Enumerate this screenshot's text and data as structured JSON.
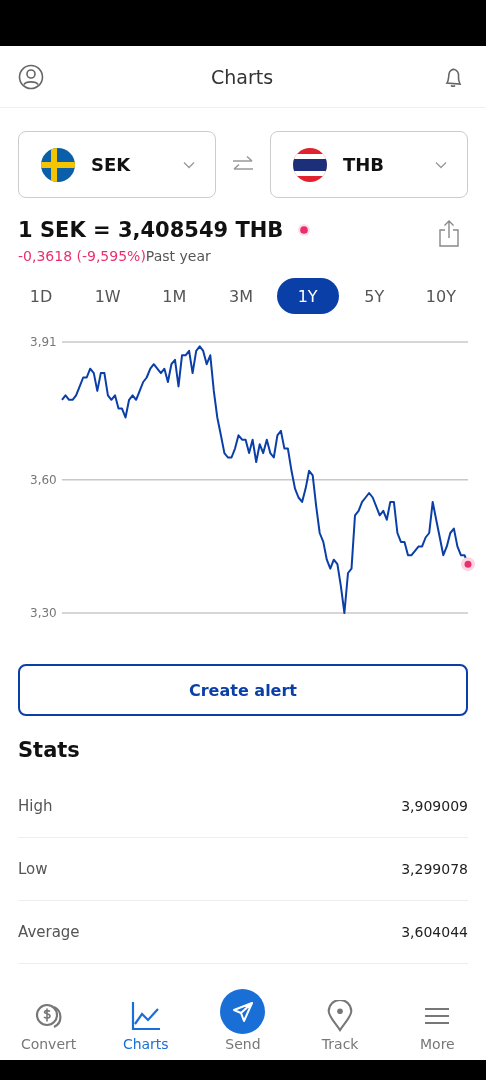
{
  "header": {
    "title": "Charts"
  },
  "pair": {
    "from": {
      "code": "SEK"
    },
    "to": {
      "code": "THB"
    }
  },
  "rate": {
    "text": "1 SEK = 3,408549 THB",
    "change": "-0,3618 (-9,595%)",
    "period": "Past year"
  },
  "periods": [
    {
      "label": "1D",
      "selected": false
    },
    {
      "label": "1W",
      "selected": false
    },
    {
      "label": "1M",
      "selected": false
    },
    {
      "label": "3M",
      "selected": false
    },
    {
      "label": "1Y",
      "selected": true
    },
    {
      "label": "5Y",
      "selected": false
    },
    {
      "label": "10Y",
      "selected": false
    }
  ],
  "chart": {
    "chart_data": {
      "type": "line",
      "ylim": [
        3.3,
        3.91
      ],
      "yticks": [
        {
          "value": 3.91,
          "label": "3,91"
        },
        {
          "value": 3.6,
          "label": "3,60"
        },
        {
          "value": 3.3,
          "label": "3,30"
        }
      ],
      "series": [
        {
          "color": "#0b3fa8",
          "values": [
            3.78,
            3.79,
            3.78,
            3.78,
            3.79,
            3.81,
            3.83,
            3.83,
            3.85,
            3.84,
            3.8,
            3.84,
            3.84,
            3.79,
            3.78,
            3.79,
            3.76,
            3.76,
            3.74,
            3.78,
            3.79,
            3.78,
            3.8,
            3.82,
            3.83,
            3.85,
            3.86,
            3.85,
            3.84,
            3.85,
            3.82,
            3.86,
            3.87,
            3.81,
            3.88,
            3.88,
            3.89,
            3.84,
            3.89,
            3.9,
            3.89,
            3.86,
            3.88,
            3.8,
            3.74,
            3.7,
            3.66,
            3.65,
            3.65,
            3.67,
            3.7,
            3.69,
            3.69,
            3.66,
            3.69,
            3.64,
            3.68,
            3.66,
            3.69,
            3.66,
            3.65,
            3.7,
            3.71,
            3.67,
            3.67,
            3.62,
            3.58,
            3.56,
            3.55,
            3.58,
            3.62,
            3.61,
            3.54,
            3.48,
            3.46,
            3.42,
            3.4,
            3.42,
            3.41,
            3.36,
            3.3,
            3.39,
            3.4,
            3.52,
            3.53,
            3.55,
            3.56,
            3.57,
            3.56,
            3.54,
            3.52,
            3.53,
            3.51,
            3.55,
            3.55,
            3.48,
            3.46,
            3.46,
            3.43,
            3.43,
            3.44,
            3.45,
            3.45,
            3.47,
            3.48,
            3.55,
            3.51,
            3.47,
            3.43,
            3.45,
            3.48,
            3.49,
            3.45,
            3.43,
            3.43,
            3.41
          ]
        }
      ]
    }
  },
  "alert_button": "Create alert",
  "stats": {
    "title": "Stats",
    "rows": [
      {
        "label": "High",
        "value": "3,909009"
      },
      {
        "label": "Low",
        "value": "3,299078"
      },
      {
        "label": "Average",
        "value": "3,604044"
      }
    ]
  },
  "nav": [
    {
      "label": "Convert",
      "kind": "convert",
      "selected": false
    },
    {
      "label": "Charts",
      "kind": "chart",
      "selected": true
    },
    {
      "label": "Send",
      "kind": "send",
      "selected": false
    },
    {
      "label": "Track",
      "kind": "track",
      "selected": false
    },
    {
      "label": "More",
      "kind": "more",
      "selected": false
    }
  ]
}
